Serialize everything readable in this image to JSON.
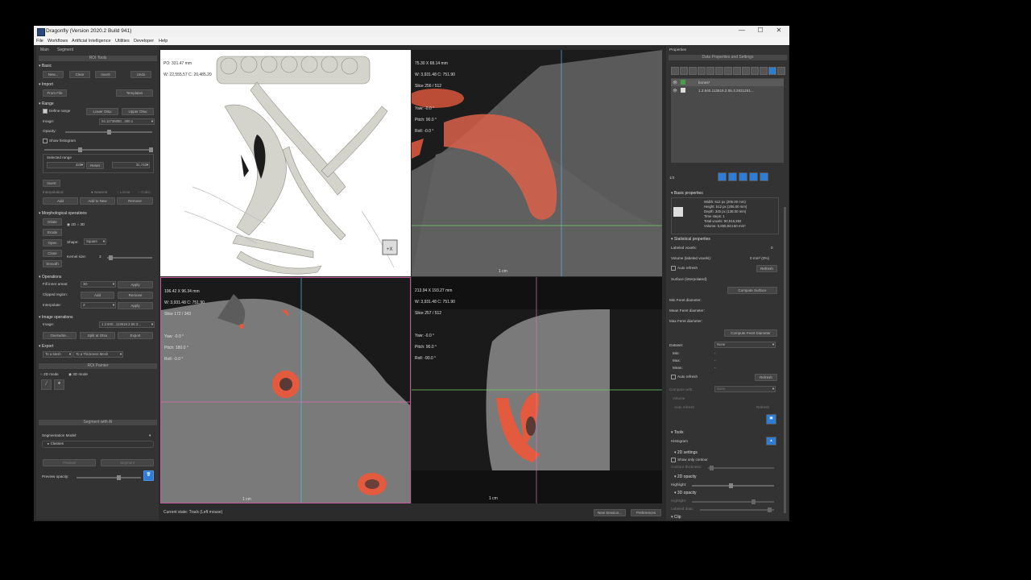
{
  "window": {
    "title": "Dragonfly (Version 2020.2 Build 941)",
    "min": "—",
    "max": "☐",
    "close": "✕"
  },
  "menu": [
    "File",
    "Workflows",
    "Artificial Intelligence",
    "Utilities",
    "Developer",
    "Help"
  ],
  "left": {
    "tabs": [
      "Main",
      "Segment"
    ],
    "roi_tools": "ROI Tools",
    "basic": {
      "title": "Basic",
      "new": "New...",
      "clear": "Clear",
      "invert": "Invert",
      "undo": "Undo"
    },
    "import": {
      "title": "Import",
      "from_file": "From File",
      "templates": "Templates"
    },
    "range": {
      "title": "Range",
      "define_range": "Define range",
      "lower_otsu": "Lower Otsu",
      "upper_otsu": "Upper Otsu",
      "image_label": "Image:",
      "image_value": "04.11736050...300.1",
      "opacity_label": "Opacity:",
      "show_histogram": "Show histogram",
      "selected_range": "Selected range",
      "min": "428",
      "reset": "Reset",
      "max": "31,742",
      "invert": "Invert",
      "interpolation": "Interpolation:",
      "nearest": "Nearest",
      "linear": "Linear",
      "cubic": "Cubic",
      "add": "Add",
      "add_to_new": "Add to New",
      "remove": "Remove"
    },
    "morph": {
      "title": "Morphological operations",
      "dilate": "Dilate",
      "erode": "Erode",
      "open": "Open",
      "close": "Close",
      "smooth": "Smooth",
      "mode_2d": "2D",
      "mode_3d": "3D",
      "shape_label": "Shape:",
      "shape_value": "Square",
      "kernel_label": "Kernel size:",
      "kernel_value": "3"
    },
    "operations": {
      "title": "Operations",
      "fill_label": "Fill inner areas:",
      "fill_value": "3D",
      "apply": "Apply",
      "clipped_label": "Clipped region:",
      "add": "Add",
      "remove": "Remove",
      "interp_label": "Interpolate:",
      "interp_value": "Z"
    },
    "image_ops": {
      "title": "Image operations",
      "image_label": "Image:",
      "image_value": "1.2.840...113619.2.55.3...",
      "overwrite": "Overwrite...",
      "split_otsu": "Split at Otsu",
      "export": "Export"
    },
    "export": {
      "title": "Export",
      "to_mesh": "To a Mesh",
      "to_thickness": "To a Thickness Mesh"
    },
    "roi_painter": "ROI Painter",
    "mode_2d": "2D mode",
    "mode_3d": "3D mode",
    "segment_ai": "Segment with AI",
    "seg_model_label": "Segmentation Model:",
    "classes": "Classes",
    "preview": "Preview",
    "segment": "Segment",
    "preview_opacity": "Preview opacity:"
  },
  "views": {
    "v3d": {
      "line1": "PO: 331.47 mm",
      "line2": "W: 22,555.57 C: 20,485.20"
    },
    "tr": {
      "l1": "75.30 X 68.14 mm",
      "l2": "W: 3,931.48 C: 751.90",
      "l3": "Slice 256 / 512",
      "yaw": "Yaw: -0.0 °",
      "pitch": "Pitch: 90.0 °",
      "roll": "Roll: -0.0 °",
      "scale": "1 cm"
    },
    "bl": {
      "l1": "106.42 X 96.34 mm",
      "l2": "W: 3,931.48 C: 751.90",
      "l3": "Slice 172 / 343",
      "yaw": "Yaw: -0.0 °",
      "pitch": "Pitch: 180.0 °",
      "roll": "Roll: -0.0 °",
      "scale": "1 cm"
    },
    "br": {
      "l1": "213.94 X 193.27 mm",
      "l2": "W: 3,931.48 C: 751.90",
      "l3": "Slice 257 / 512",
      "yaw": "Yaw: -0.0 °",
      "pitch": "Pitch: 90.0 °",
      "roll": "Roll: -90.0 °",
      "scale": "1 cm"
    }
  },
  "status": {
    "text": "Current state: Track (Left mouse)",
    "new_session": "New Session...",
    "preferences": "Preferences"
  },
  "right": {
    "title": "Properties",
    "data_props": "Data Properties and Settings",
    "items": [
      "bones*",
      "1.2.840.113619.2.55.3.2831261..."
    ],
    "count": "1/2",
    "basic_props": "Basic properties",
    "info": [
      "Width: 512 px (206.00 mm)",
      "Height: 512 px (206.00 mm)",
      "Depth: 345 px (138.00 mm)",
      "Time steps: 1",
      "Total voxels: 90,915,392",
      "Volume: 5,855,944.60 mm³"
    ],
    "stat_props": "Statistical properties",
    "labeled_voxels": "Labeled voxels:",
    "labeled_value": "0",
    "volume_label": "Volume (labeled voxels):",
    "volume_value": "0 mm³ (0%)",
    "auto_refresh": "Auto refresh",
    "refresh": "Refresh",
    "surface": "Surface (interpolated):",
    "compute_surface": "Compute Surface",
    "min_feret": "Min Feret diameter:",
    "mean_feret": "Mean Feret diameter:",
    "max_feret": "Max Feret diameter:",
    "compute_feret": "Compute Feret Diameter",
    "dataset": "Dataset:",
    "dataset_value": "None",
    "min": "Min:",
    "max": "Max:",
    "mean": "Mean:",
    "dash": "-",
    "compare": "Compare with:",
    "compare_value": "None",
    "volume": "Volume",
    "tools": "Tools",
    "histogram": "Histogram",
    "settings2d": "2D settings",
    "show_contour": "Show only contour",
    "contour_thick": "Contour thickness:",
    "opacity2d": "2D opacity",
    "highlight": "Highlight:",
    "opacity3d": "3D opacity",
    "labeled_data": "Labeled data:",
    "clip": "Clip"
  },
  "colors": {
    "roi": "#e35a3f",
    "accent": "#2d7cd6",
    "crosshair_green": "#6fd26f",
    "crosshair_blue": "#5ab2f0",
    "crosshair_pink": "#d86fb0"
  }
}
